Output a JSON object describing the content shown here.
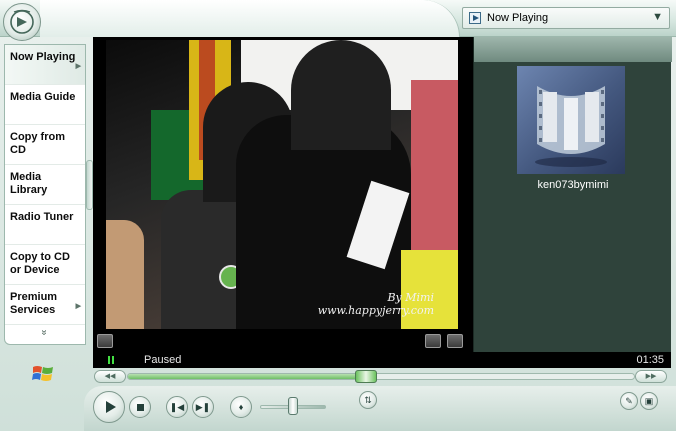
{
  "window": {
    "app": "Windows Media Player"
  },
  "view_selector": {
    "label": "Now Playing",
    "icon": "now-playing-icon"
  },
  "nav": {
    "items": [
      {
        "label": "Now Playing",
        "active": true,
        "has_arrow": true
      },
      {
        "label": "Media Guide",
        "active": false,
        "has_arrow": false
      },
      {
        "label": "Copy from CD",
        "active": false,
        "has_arrow": false
      },
      {
        "label": "Media Library",
        "active": false,
        "has_arrow": false
      },
      {
        "label": "Radio Tuner",
        "active": false,
        "has_arrow": false
      },
      {
        "label": "Copy to CD or Device",
        "active": false,
        "has_arrow": false
      },
      {
        "label": "Premium Services",
        "active": false,
        "has_arrow": true
      }
    ],
    "more_glyph": "»"
  },
  "video": {
    "watermark_line1": "By Mimi",
    "watermark_line2": "www.happyjerry.com"
  },
  "playlist": {
    "item_title": "ken073bymimi",
    "thumbnail_icon": "film-strip-icon"
  },
  "status": {
    "state": "Paused",
    "time": "01:35"
  },
  "seek": {
    "position_fraction": 0.47
  },
  "volume": {
    "level_fraction": 0.5
  },
  "colors": {
    "accent_green": "#43e043",
    "frame": "#cfe0d9",
    "playlist_bg": "#2f433b"
  }
}
